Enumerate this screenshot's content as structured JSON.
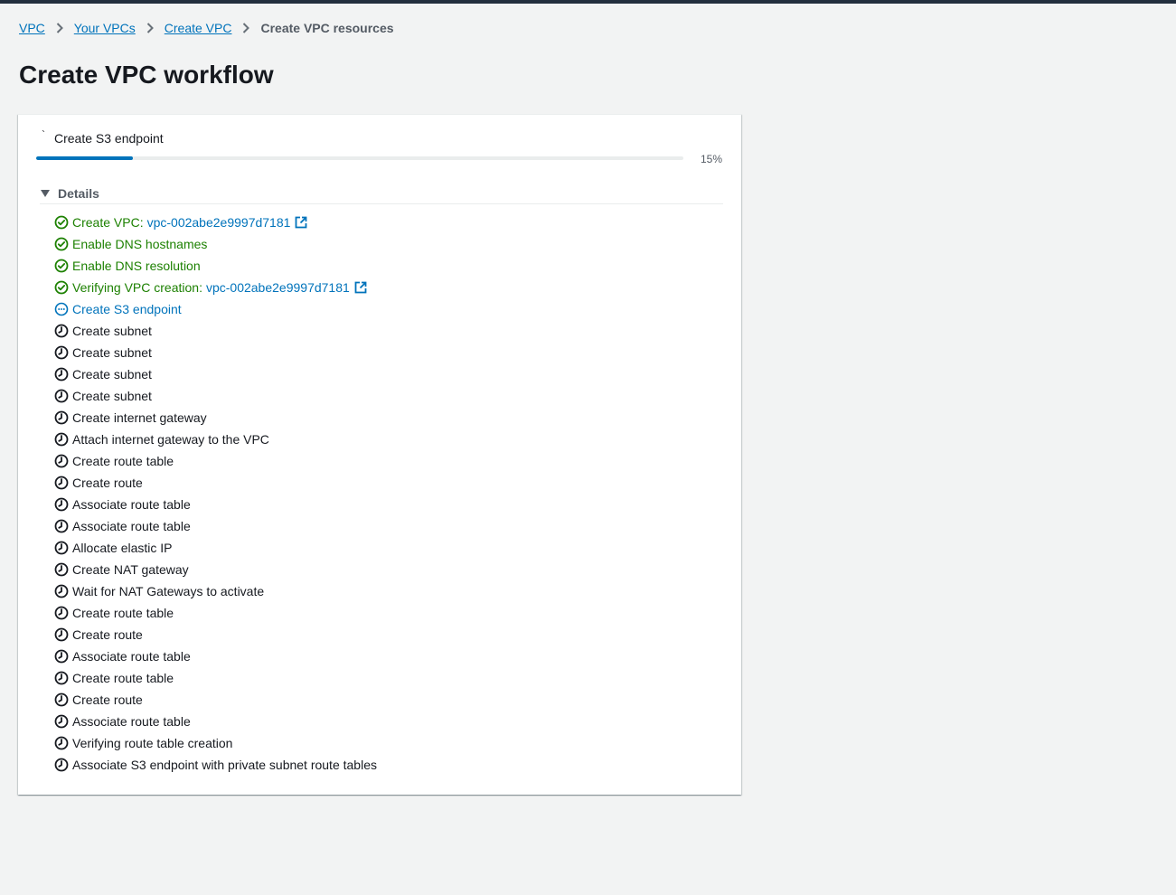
{
  "breadcrumb": {
    "items": [
      {
        "label": "VPC"
      },
      {
        "label": "Your VPCs"
      },
      {
        "label": "Create VPC"
      }
    ],
    "current": "Create VPC resources"
  },
  "page": {
    "title": "Create VPC workflow"
  },
  "progress": {
    "tick": "`",
    "label": "Create S3 endpoint",
    "percent_text": "15%",
    "value": 0.15
  },
  "details": {
    "label": "Details",
    "expanded": true
  },
  "colors": {
    "success": "#1d8102",
    "in_progress": "#0073bb",
    "pending": "#16191f",
    "link": "#0073bb",
    "progress_fill": "#0073bb"
  },
  "steps": [
    {
      "status": "success",
      "icon": "check-circle-icon",
      "text": "Create VPC:",
      "link": "vpc-002abe2e9997d7181",
      "external": true
    },
    {
      "status": "success",
      "icon": "check-circle-icon",
      "text": "Enable DNS hostnames"
    },
    {
      "status": "success",
      "icon": "check-circle-icon",
      "text": "Enable DNS resolution"
    },
    {
      "status": "success",
      "icon": "check-circle-icon",
      "text": "Verifying VPC creation:",
      "link": "vpc-002abe2e9997d7181",
      "external": true
    },
    {
      "status": "in-progress",
      "icon": "in-progress-icon",
      "text": "Create S3 endpoint"
    },
    {
      "status": "pending",
      "icon": "clock-icon",
      "text": "Create subnet"
    },
    {
      "status": "pending",
      "icon": "clock-icon",
      "text": "Create subnet"
    },
    {
      "status": "pending",
      "icon": "clock-icon",
      "text": "Create subnet"
    },
    {
      "status": "pending",
      "icon": "clock-icon",
      "text": "Create subnet"
    },
    {
      "status": "pending",
      "icon": "clock-icon",
      "text": "Create internet gateway"
    },
    {
      "status": "pending",
      "icon": "clock-icon",
      "text": "Attach internet gateway to the VPC"
    },
    {
      "status": "pending",
      "icon": "clock-icon",
      "text": "Create route table"
    },
    {
      "status": "pending",
      "icon": "clock-icon",
      "text": "Create route"
    },
    {
      "status": "pending",
      "icon": "clock-icon",
      "text": "Associate route table"
    },
    {
      "status": "pending",
      "icon": "clock-icon",
      "text": "Associate route table"
    },
    {
      "status": "pending",
      "icon": "clock-icon",
      "text": "Allocate elastic IP"
    },
    {
      "status": "pending",
      "icon": "clock-icon",
      "text": "Create NAT gateway"
    },
    {
      "status": "pending",
      "icon": "clock-icon",
      "text": "Wait for NAT Gateways to activate"
    },
    {
      "status": "pending",
      "icon": "clock-icon",
      "text": "Create route table"
    },
    {
      "status": "pending",
      "icon": "clock-icon",
      "text": "Create route"
    },
    {
      "status": "pending",
      "icon": "clock-icon",
      "text": "Associate route table"
    },
    {
      "status": "pending",
      "icon": "clock-icon",
      "text": "Create route table"
    },
    {
      "status": "pending",
      "icon": "clock-icon",
      "text": "Create route"
    },
    {
      "status": "pending",
      "icon": "clock-icon",
      "text": "Associate route table"
    },
    {
      "status": "pending",
      "icon": "clock-icon",
      "text": "Verifying route table creation"
    },
    {
      "status": "pending",
      "icon": "clock-icon",
      "text": "Associate S3 endpoint with private subnet route tables"
    }
  ]
}
